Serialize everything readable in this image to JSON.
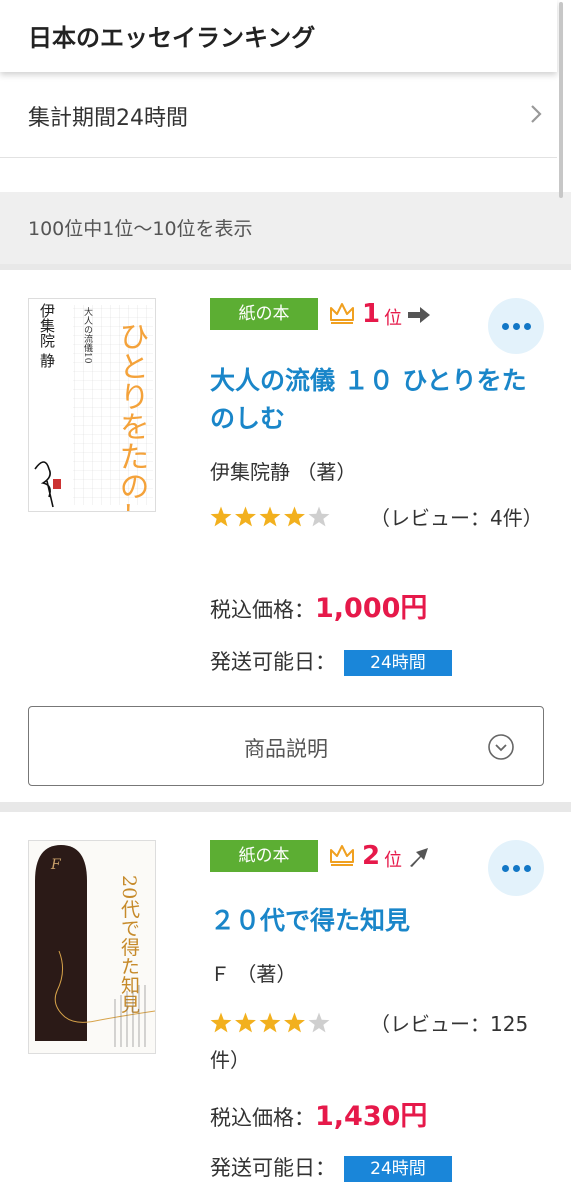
{
  "header": {
    "title": "日本のエッセイランキング"
  },
  "period": {
    "label": "集計期間24時間",
    "chevron_icon": "chevron-right-icon"
  },
  "count": {
    "text": "100位中1位〜10位を表示"
  },
  "items": [
    {
      "badge": "紙の本",
      "rank_number": "1",
      "rank_suffix": "位",
      "rank_trend": "flat",
      "title": "大人の流儀 １０ ひとりをたのしむ",
      "author": "伊集院静 （著）",
      "rating": 4,
      "reviews": "（レビュー：4件）",
      "price_label": "税込価格：",
      "price": "1,000円",
      "ship_label": "発送可能日：",
      "ship_value": "24時間",
      "description_button": "商品説明",
      "cover": {
        "main_title": "ひとりをたのしむ",
        "series": "大人の流儀10",
        "author": "伊集院 静"
      }
    },
    {
      "badge": "紙の本",
      "rank_number": "2",
      "rank_suffix": "位",
      "rank_trend": "up",
      "title": "２０代で得た知見",
      "author": "Ｆ （著）",
      "rating": 4,
      "reviews": "（レビュー：125件）",
      "price_label": "税込価格：",
      "price": "1,430円",
      "ship_label": "発送可能日：",
      "ship_value": "24時間",
      "cover": {
        "letter": "F",
        "title": "20代で得た知見"
      }
    }
  ],
  "colors": {
    "accent_blue": "#1a86c9",
    "rank_red": "#e6194a",
    "badge_green": "#5cae33",
    "star_gold": "#f2b01e",
    "star_gray": "#cfcfcf",
    "ship_blue": "#1a86d9",
    "crown_orange": "#f0a020"
  }
}
